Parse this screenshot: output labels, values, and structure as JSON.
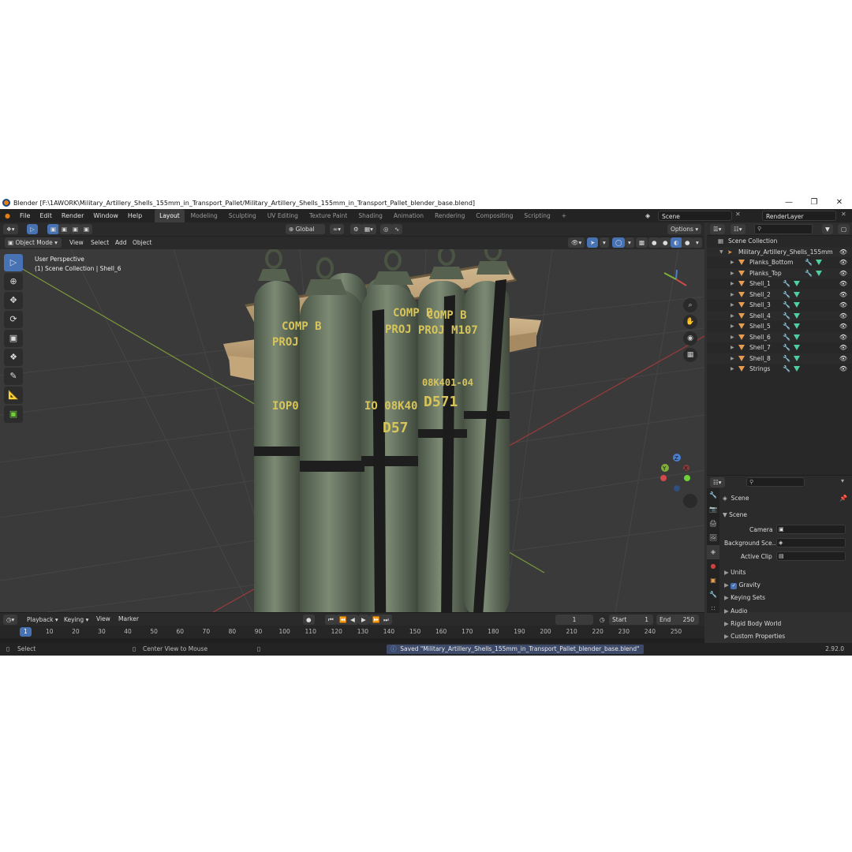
{
  "window": {
    "title": "Blender [F:\\1AWORK\\Military_Artillery_Shells_155mm_in_Transport_Pallet/Military_Artillery_Shells_155mm_in_Transport_Pallet_blender_base.blend]"
  },
  "menu": [
    "File",
    "Edit",
    "Render",
    "Window",
    "Help"
  ],
  "workspaces": [
    "Layout",
    "Modeling",
    "Sculpting",
    "UV Editing",
    "Texture Paint",
    "Shading",
    "Animation",
    "Rendering",
    "Compositing",
    "Scripting"
  ],
  "scene_name": "Scene",
  "view_layer": "RenderLayer",
  "header": {
    "mode": "Object Mode",
    "view": "View",
    "select": "Select",
    "add": "Add",
    "object": "Object",
    "transform_orientation": "Global",
    "options": "Options"
  },
  "viewport": {
    "perspective": "User Perspective",
    "collection_info": "(1) Scene Collection | Shell_6",
    "gizmo_labels": [
      "X",
      "Y",
      "Z"
    ],
    "shell_text": {
      "a1": "COMP B",
      "a2": "PROJ",
      "a3": "IOP0",
      "b1": "COMP B",
      "b2": "PROJ",
      "b3": "IO 08K40",
      "b4": "D57",
      "c1": "COMP B",
      "c2": "PROJ M107",
      "c3": "08K401-04",
      "c4": "D571"
    }
  },
  "outliner": {
    "root": "Scene Collection",
    "collection": "Military_Artillery_Shells_155mm",
    "items": [
      "Planks_Bottom",
      "Planks_Top",
      "Shell_1",
      "Shell_2",
      "Shell_3",
      "Shell_4",
      "Shell_5",
      "Shell_6",
      "Shell_7",
      "Shell_8",
      "Strings"
    ]
  },
  "properties": {
    "context": "Scene",
    "panel": "Scene",
    "camera_label": "Camera",
    "background_label": "Background Sce...",
    "active_clip_label": "Active Clip",
    "subpanels": [
      "Units",
      "Gravity",
      "Keying Sets",
      "Audio",
      "Rigid Body World",
      "Custom Properties"
    ],
    "gravity_enabled": true
  },
  "timeline": {
    "menus": [
      "Playback",
      "Keying",
      "View",
      "Marker"
    ],
    "current_frame": "1",
    "start_label": "Start",
    "start": "1",
    "end_label": "End",
    "end": "250",
    "ticks": [
      "1",
      "10",
      "20",
      "30",
      "40",
      "50",
      "60",
      "70",
      "80",
      "90",
      "100",
      "110",
      "120",
      "130",
      "140",
      "150",
      "160",
      "170",
      "180",
      "190",
      "200",
      "210",
      "220",
      "230",
      "240",
      "250"
    ]
  },
  "status": {
    "left": "Select",
    "middle": "Center View to Mouse",
    "message": "Saved \"Military_Artillery_Shells_155mm_in_Transport_Pallet_blender_base.blend\"",
    "version": "2.92.0"
  }
}
